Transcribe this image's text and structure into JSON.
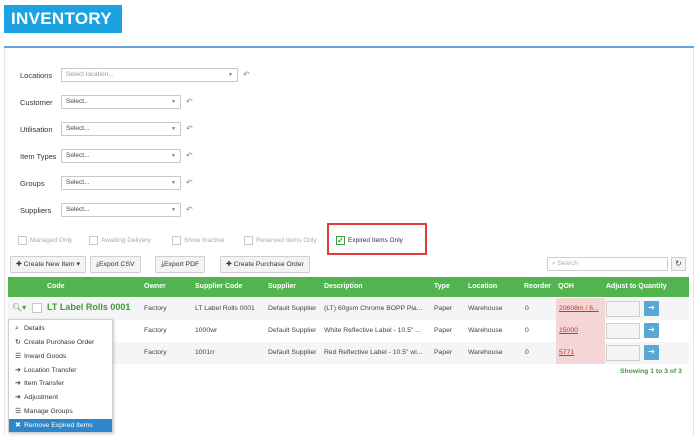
{
  "page": {
    "title": "INVENTORY"
  },
  "filters": [
    {
      "label": "Locations",
      "value": "Select location..."
    },
    {
      "label": "Customer",
      "value": "Select.."
    },
    {
      "label": "Utilisation",
      "value": "Select..."
    },
    {
      "label": "Item Types",
      "value": "Select..."
    },
    {
      "label": "Groups",
      "value": "Select..."
    },
    {
      "label": "Suppliers",
      "value": "Select..."
    }
  ],
  "checkboxes": [
    {
      "label": "Managed Only",
      "checked": false
    },
    {
      "label": "Awaiting Delivery",
      "checked": false
    },
    {
      "label": "Show Inactive",
      "checked": false
    },
    {
      "label": "Reserved Items Only",
      "checked": false
    },
    {
      "label": "Expired Items Only",
      "checked": true
    }
  ],
  "toolbar": {
    "create_new_item": "Create New Item",
    "export_csv": "Export CSV",
    "export_pdf": "Export PDF",
    "create_po": "Create Purchase Order",
    "search_placeholder": "Search"
  },
  "table": {
    "columns": [
      "Code",
      "Owner",
      "Supplier Code",
      "Supplier",
      "Description",
      "Type",
      "Location",
      "Reorder",
      "QOH",
      "Adjust to Quantity"
    ],
    "rows": [
      {
        "code": "LT Label Rolls 0001",
        "owner": "Factory",
        "supplier_code": "LT Label Rolls 0001",
        "supplier": "Default Supplier",
        "description": "(LT) 60gsm Chrome BOPP Pla...",
        "type": "Paper",
        "location": "Warehouse",
        "reorder": "0",
        "qoh": "20608m / 6..."
      },
      {
        "code": "",
        "owner": "Factory",
        "supplier_code": "1000wr",
        "supplier": "Default Supplier",
        "description": "White Reflective Label - 10.5\" ...",
        "type": "Paper",
        "location": "Warehouse",
        "reorder": "0",
        "qoh": "15000"
      },
      {
        "code": "",
        "owner": "Factory",
        "supplier_code": "1001rr",
        "supplier": "Default Supplier",
        "description": "Red Reflective Label - 10.5\" wi...",
        "type": "Paper",
        "location": "Warehouse",
        "reorder": "0",
        "qoh": "5771"
      }
    ],
    "showing": "Showing 1 to 3 of 3"
  },
  "row_menu": [
    {
      "label": "Details",
      "icon": "search-icon"
    },
    {
      "label": "Create Purchase Order",
      "icon": "refresh-icon"
    },
    {
      "label": "Inward Goods",
      "icon": "list-icon"
    },
    {
      "label": "Location Transfer",
      "icon": "arrow-right-icon"
    },
    {
      "label": "Item Transfer",
      "icon": "arrow-right-icon"
    },
    {
      "label": "Adjustment",
      "icon": "arrow-right-icon"
    },
    {
      "label": "Manage Groups",
      "icon": "list-icon"
    },
    {
      "label": "Remove Expired Items",
      "icon": "x-icon",
      "active": true
    }
  ],
  "colors": {
    "title_bg": "#1aa3e0",
    "table_header": "#52b44e",
    "highlight": "#e23b3b",
    "menu_active": "#2e86c8",
    "qoh_bg": "#f4d6d6"
  }
}
